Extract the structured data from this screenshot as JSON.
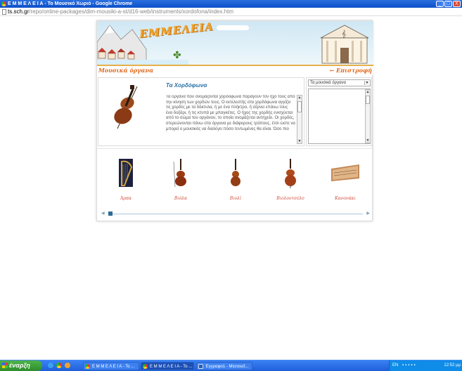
{
  "window": {
    "title": "Ε Μ Μ Ε Λ Ε Ι Α - Το Μουσικό Χωριό - Google Chrome",
    "controls": [
      "_",
      "□",
      "X"
    ]
  },
  "address_bar": {
    "host": "ts.sch.gr",
    "path": "/repo/online-packages/dim-mousiki-a-st/d16-web/instruments/xordofona/index.htm"
  },
  "app": {
    "logo": "ΕΜΜΕΛΕΙΑ",
    "section_title": "Μουσικά όργανα",
    "back_link": "← Επιστροφή",
    "instrument_title": "Τα Χορδόφωνα",
    "description": "Τα όργανα που ονομάζονται χορδόφωνα παράγουν τον ήχο τους από την κίνηση των χορδών τους. Ο εκτελεστής στα χορδόφωνα αγγίζει τις χορδές με τα δάκτυλα, ή με ένα πλήκτρο, ή σέρνει επάνω τους ένα δοξάρι, ή τις κτυπά με μπαγκέτες. Ο ήχος της χορδής ενισχύεται από το σώμα του οργάνου, το οποίο ονομάζεται αντηχείο. Οι χορδές, στερεώνονται πάνω στα όργανα με διάφορους τρόπους, έτσι ώστε να μπορεί ο μουσικός να διαλέγει πόσο τεντωμένες θα είναι. Όσο πιο",
    "dropdown_value": "Τα μουσικά όργανα",
    "instruments": [
      {
        "label": "Άρπα",
        "icon": "harp-icon"
      },
      {
        "label": "Βιόλα",
        "icon": "viola-icon"
      },
      {
        "label": "Βιολί",
        "icon": "violin-icon"
      },
      {
        "label": "Βιολοντσέλο",
        "icon": "cello-icon"
      },
      {
        "label": "Κανονάκι",
        "icon": "kanonaki-icon"
      }
    ]
  },
  "taskbar": {
    "start_label": "έναρξη",
    "tasks": [
      {
        "label": "Ε Μ Μ Ε Λ Ε Ι Α - Το ...",
        "icon": "chrome-icon",
        "active": false
      },
      {
        "label": "Ε Μ Μ Ε Λ Ε Ι Α - Το ...",
        "icon": "chrome-icon",
        "active": true
      },
      {
        "label": "Έγγραφο1 - Microsof...",
        "icon": "word-icon",
        "active": false
      }
    ],
    "tray": {
      "language": "EN",
      "clock": "12:52 μμ"
    }
  },
  "colors": {
    "accent_orange": "#e06a1e",
    "title_blue": "#2a72a8",
    "label_red": "#d04b3c",
    "taskbar_blue": "#1f5fd8"
  }
}
